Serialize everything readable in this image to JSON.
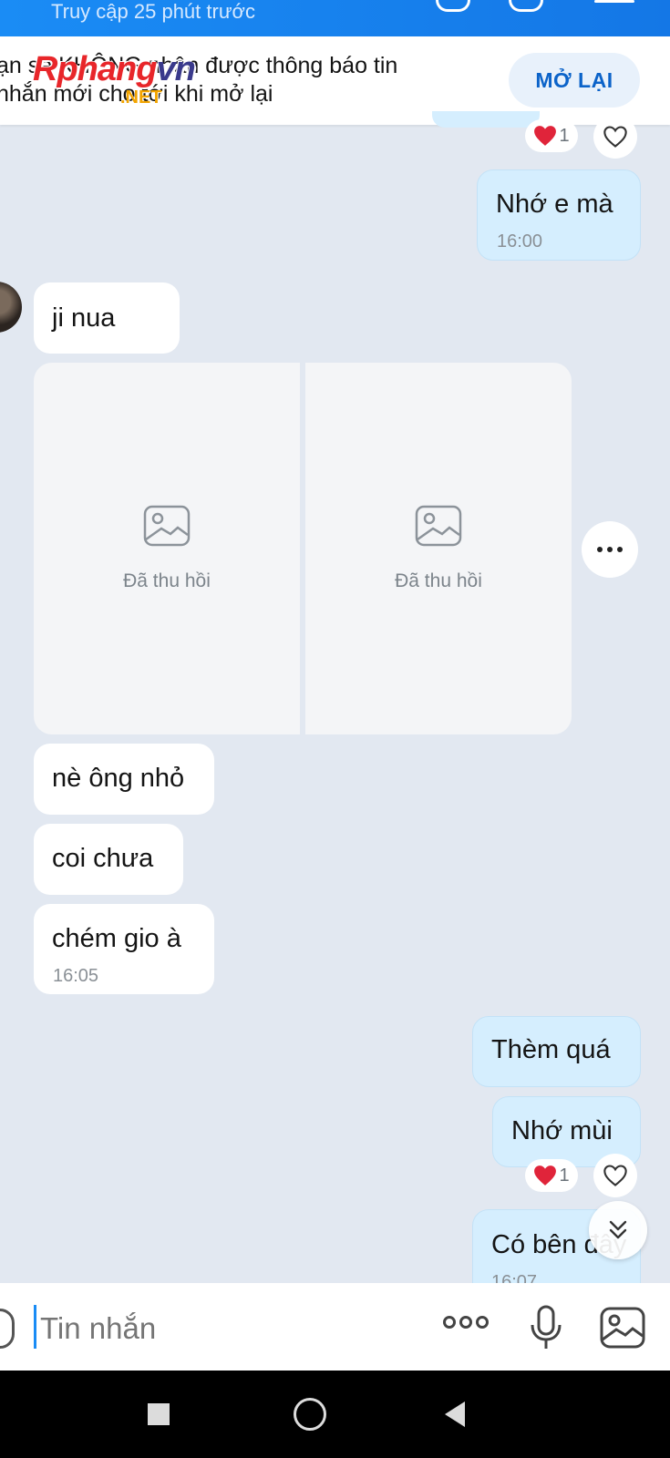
{
  "header": {
    "subtitle": "Truy cập 25 phút trước"
  },
  "banner": {
    "line1": "ạn sẽ KHÔNG nhận được thông báo tin",
    "line2": "nhắn mới cho tới khi mở lại",
    "button_label": "MỞ LẠI",
    "watermark_main": "Rphang",
    "watermark_vn": "vn",
    "watermark_net": ".NET"
  },
  "messages": {
    "m1_reaction_count": "1",
    "m2_text": "Nhớ e mà",
    "m2_time": "16:00",
    "m3_text": "ji nua",
    "photo1_label": "Đã thu hồi",
    "photo2_label": "Đã thu hồi",
    "m4_text": "nè ông nhỏ",
    "m5_text": "coi chưa",
    "m6_text": "chém gio à",
    "m6_time": "16:05",
    "m7_text": "Thèm quá",
    "m8_text": "Nhớ mùi",
    "m8_reaction_count": "1",
    "m9_text": "Có bên đây",
    "m9_time": "16:07"
  },
  "composer": {
    "placeholder": "Tin nhắn"
  },
  "icons": {
    "heart": "heart-icon",
    "image": "image-icon",
    "mic": "microphone-icon",
    "more": "more-dots-icon",
    "scroll": "double-chevron-down-icon"
  },
  "colors": {
    "accent": "#1a8cf5",
    "outgoing_bubble": "#d5eefe",
    "chat_bg": "#e2e8f1",
    "heart": "#e0243a"
  }
}
